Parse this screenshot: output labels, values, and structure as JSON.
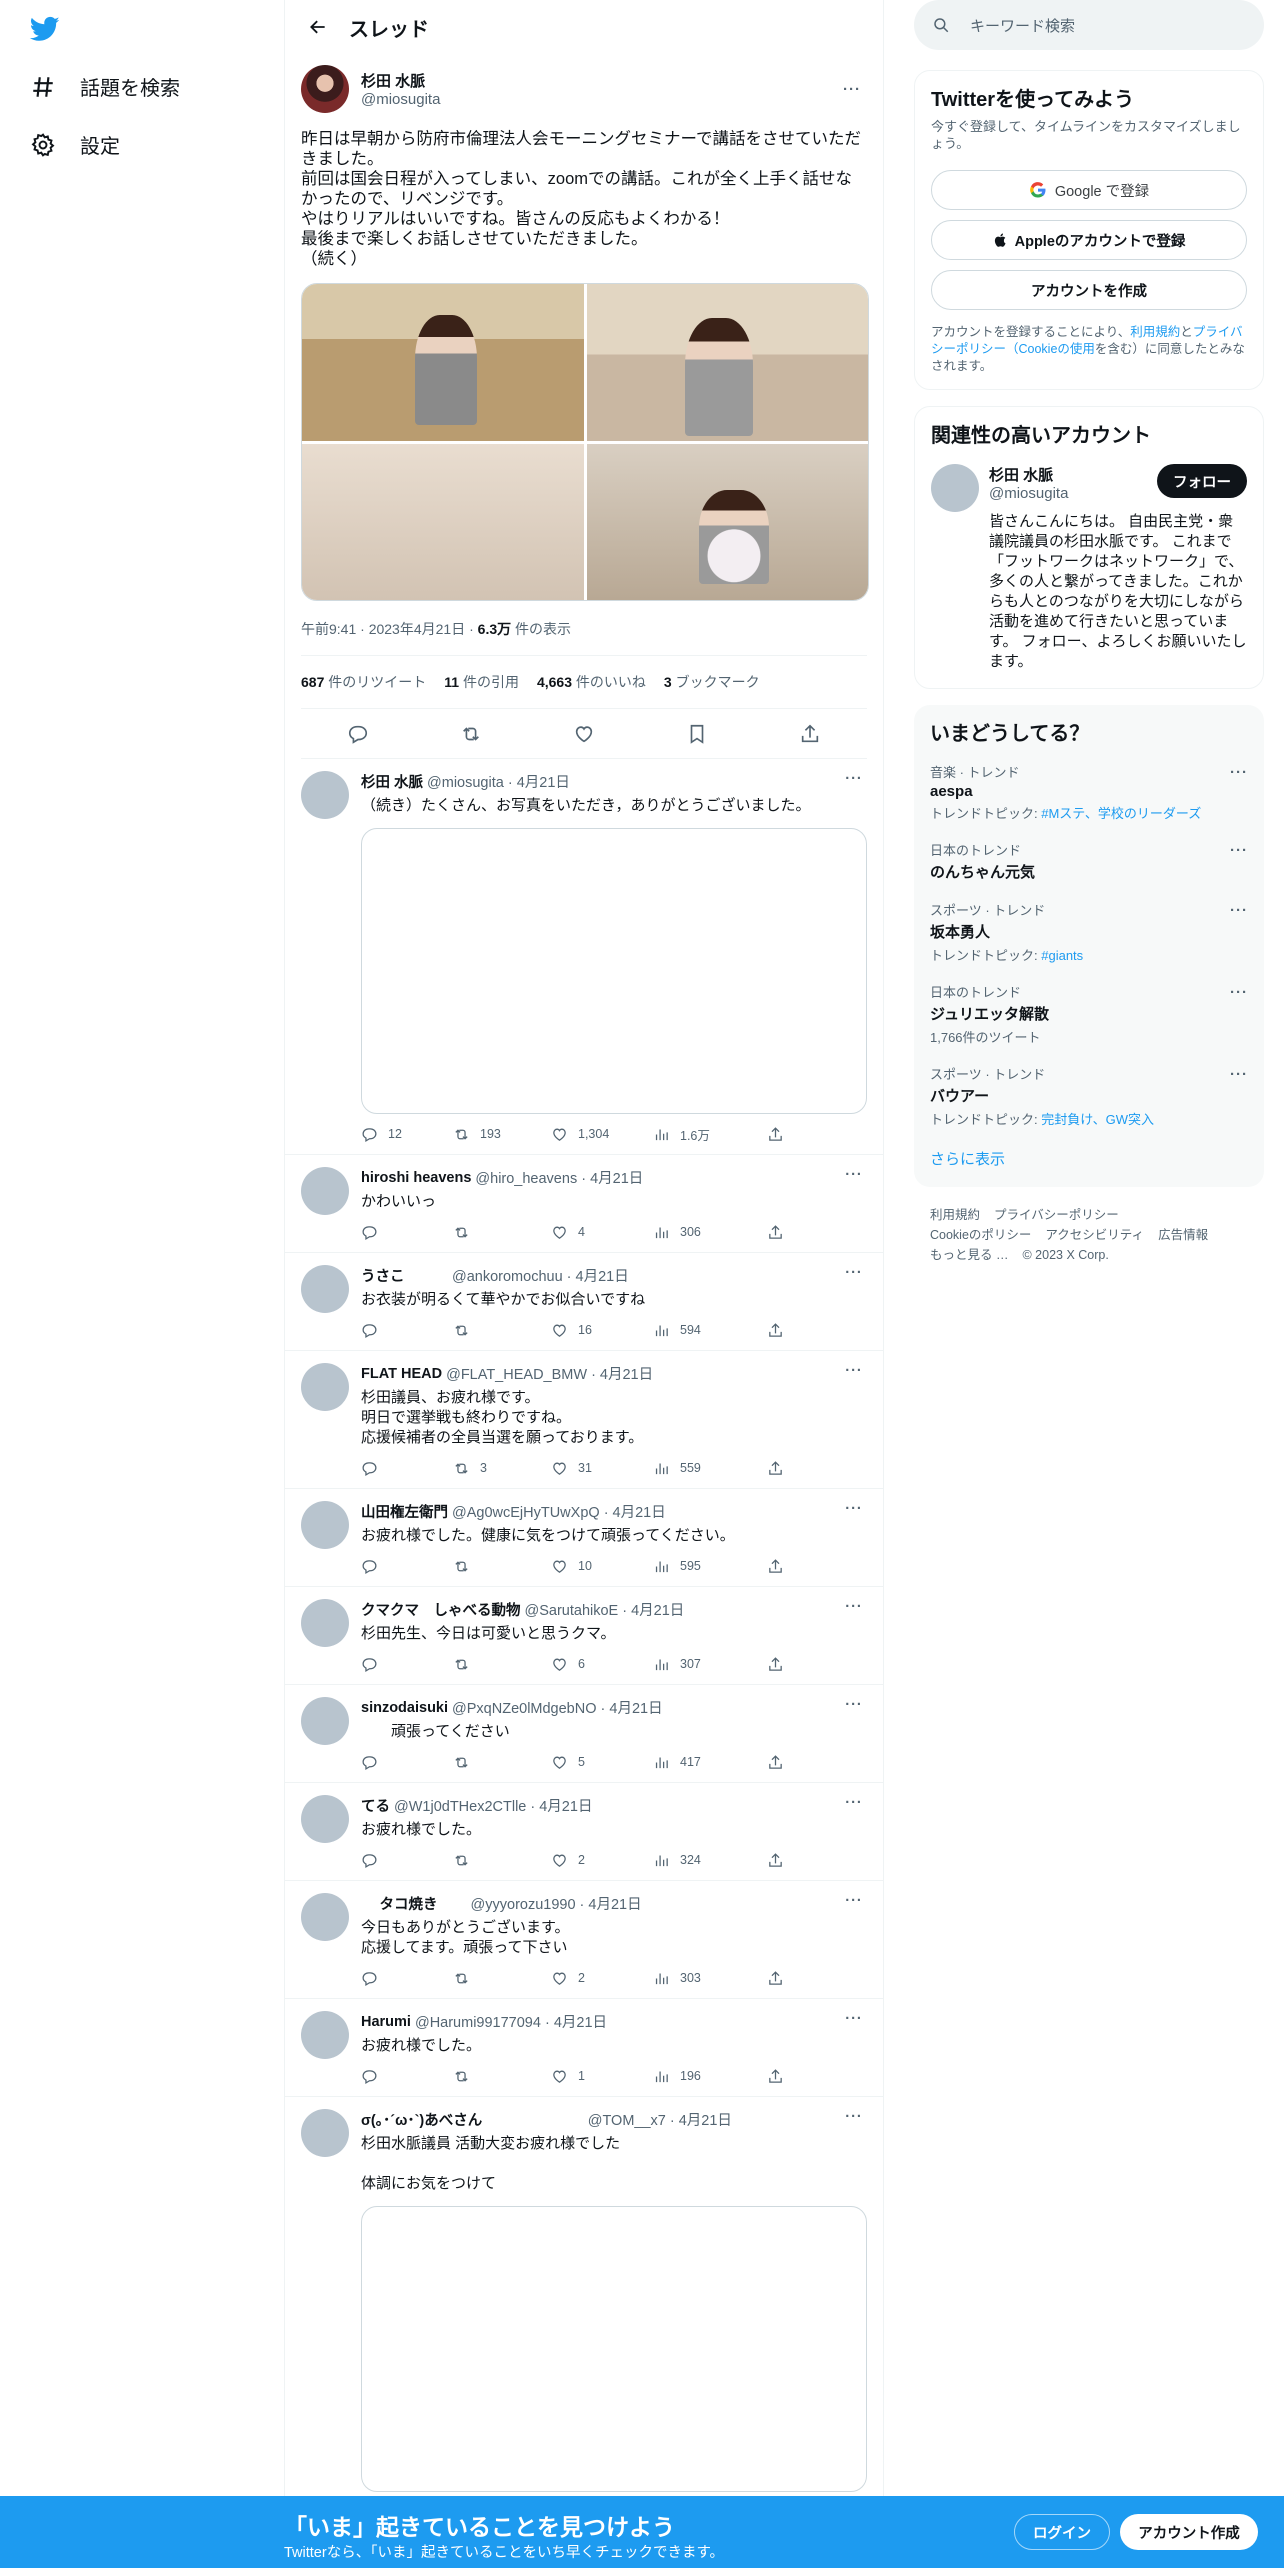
{
  "colors": {
    "accent": "#1d9bf0",
    "text": "#0f1419",
    "muted": "#536471"
  },
  "nav": {
    "logo": "twitter-bird",
    "items": [
      {
        "label": "話題を検索",
        "icon": "hashtag-icon"
      },
      {
        "label": "設定",
        "icon": "gear-icon"
      }
    ]
  },
  "header": {
    "title": "スレッド"
  },
  "post": {
    "name": "杉田 水脈",
    "handle": "@miosugita",
    "text": "昨日は早朝から防府市倫理法人会モーニングセミナーで講話をさせていただきました。\n前回は国会日程が入ってしまい、zoomでの講話。これが全く上手く話せなかったので、リベンジです。\nやはりリアルはいいですね。皆さんの反応もよくわかる！\n最後まで楽しくお話しさせていただきました。\n（続く）",
    "time": "午前9:41",
    "date": "2023年4月21日",
    "views_num": "6.3万",
    "views_label": " 件の表示",
    "retweets_num": "687",
    "retweets_label": " 件のリツイート",
    "quotes_num": "11",
    "quotes_label": " 件の引用",
    "likes_num": "4,663",
    "likes_label": " 件のいいね",
    "bookmarks_num": "3",
    "bookmarks_label": " ブックマーク"
  },
  "replies": [
    {
      "name": "杉田 水脈",
      "handle": "@miosugita · 4月21日",
      "text": "（続き）たくさん、お写真をいただき，ありがとうございました。",
      "media": true,
      "replies": "12",
      "retweets": "193",
      "likes": "1,304",
      "views": "1.6万"
    },
    {
      "name": "hiroshi heavens",
      "handle": "@hiro_heavens · 4月21日",
      "text": "かわいいっ",
      "replies": "",
      "retweets": "",
      "likes": "4",
      "views": "306"
    },
    {
      "name": "うさこ",
      "handle": "　　　@ankoromochuu · 4月21日",
      "text": "お衣装が明るくて華やかでお似合いですね",
      "replies": "",
      "retweets": "",
      "likes": "16",
      "views": "594"
    },
    {
      "name": "FLAT HEAD",
      "handle": "@FLAT_HEAD_BMW · 4月21日",
      "text": "杉田議員、お疲れ様です。\n明日で選挙戦も終わりですね。\n応援候補者の全員当選を願っております。",
      "replies": "",
      "retweets": "3",
      "likes": "31",
      "views": "559"
    },
    {
      "name": "山田権左衛門",
      "handle": "@Ag0wcEjHyTUwXpQ · 4月21日",
      "text": "お疲れ様でした。健康に気をつけて頑張ってください。",
      "replies": "",
      "retweets": "",
      "likes": "10",
      "views": "595"
    },
    {
      "name": "クマクマ　しゃべる動物",
      "handle": "@SarutahikoE · 4月21日",
      "text": "杉田先生、今日は可愛いと思うクマ。",
      "replies": "",
      "retweets": "",
      "likes": "6",
      "views": "307"
    },
    {
      "name": "sinzodaisuki",
      "handle": "@PxqNZe0lMdgebNO · 4月21日",
      "text": "　　頑張ってください",
      "replies": "",
      "retweets": "",
      "likes": "5",
      "views": "417"
    },
    {
      "name": "てる",
      "handle": "@W1j0dTHex2CTlle · 4月21日",
      "text": "お疲れ様でした。",
      "replies": "",
      "retweets": "",
      "likes": "2",
      "views": "324"
    },
    {
      "name": "　 タコ焼き",
      "handle": "　　@yyyorozu1990 · 4月21日",
      "text": "今日もありがとうございます。\n応援してます。頑張って下さい",
      "replies": "",
      "retweets": "",
      "likes": "2",
      "views": "303"
    },
    {
      "name": "Harumi",
      "handle": "@Harumi99177094 · 4月21日",
      "text": "お疲れ様でした。",
      "replies": "",
      "retweets": "",
      "likes": "1",
      "views": "196"
    },
    {
      "name": "σ(｡･´ω･`)あべさん",
      "handle": "　　　　　　　@TOM__x7 · 4月21日",
      "text": "杉田水脈議員 活動大変お疲れ様でした\n\n体調にお気をつけて",
      "media": true
    }
  ],
  "search": {
    "placeholder": "キーワード検索"
  },
  "signup": {
    "title": "Twitterを使ってみよう",
    "sub": "今すぐ登録して、タイムラインをカスタマイズしましょう。",
    "google": "Google で登録",
    "apple": "Appleのアカウントで登録",
    "create": "アカウントを作成",
    "terms_a": "アカウントを登録することにより、",
    "terms_link1": "利用規約",
    "terms_b": "と",
    "terms_link2": "プライバシーポリシー（Cookieの使用",
    "terms_c": "を含む）に同意したとみなされます。"
  },
  "related": {
    "title": "関連性の高いアカウント",
    "name": "杉田 水脈",
    "handle": "@miosugita",
    "follow": "フォロー",
    "bio": "皆さんこんにちは。 自由民主党・衆議院議員の杉田水脈です。 これまで「フットワークはネットワーク」で、多くの人と繋がってきました。これからも人とのつながりを大切にしながら活動を進めて行きたいと思っています。 フォロー、よろしくお願いいたします。"
  },
  "trends": {
    "title": "いまどうしてる？",
    "items": [
      {
        "cat": "音楽 · トレンド",
        "name": "aespa",
        "topic_label": "トレンドトピック: ",
        "topic": "#Mステ、学校のリーダーズ"
      },
      {
        "cat": "日本のトレンド",
        "name": "のんちゃん元気"
      },
      {
        "cat": "スポーツ · トレンド",
        "name": "坂本勇人",
        "topic_label": "トレンドトピック: ",
        "topic": "#giants"
      },
      {
        "cat": "日本のトレンド",
        "name": "ジュリエッタ解散",
        "count": "1,766件のツイート"
      },
      {
        "cat": "スポーツ · トレンド",
        "name": "バウアー",
        "topic_label": "トレンドトピック: ",
        "topic": "完封負け、GW突入"
      }
    ],
    "more": "さらに表示"
  },
  "footer": {
    "links": [
      "利用規約",
      "プライバシーポリシー",
      "Cookieのポリシー",
      "アクセシビリティ",
      "広告情報",
      "もっと見る …"
    ],
    "copyright": "© 2023 X Corp."
  },
  "banner": {
    "title": "「いま」起きていることを見つけよう",
    "sub": "Twitterなら、「いま」起きていることをいち早くチェックできます。",
    "login": "ログイン",
    "signup": "アカウント作成"
  }
}
